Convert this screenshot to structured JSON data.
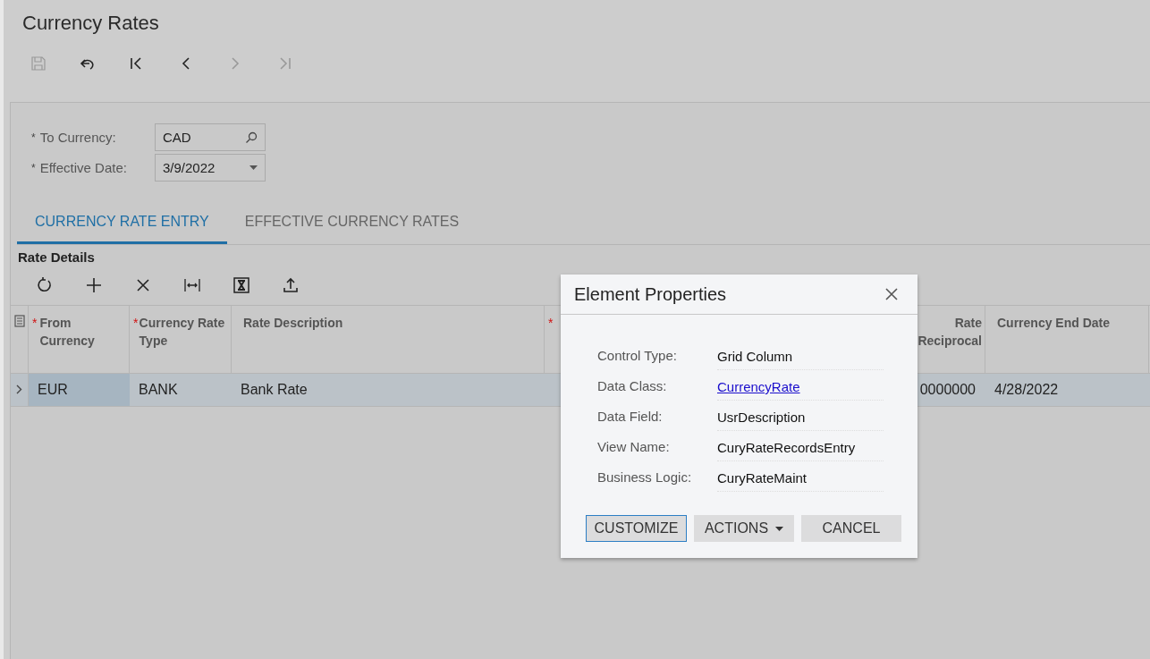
{
  "page": {
    "title": "Currency Rates"
  },
  "toolbar": [
    {
      "kind": "save",
      "disabled": true
    },
    {
      "kind": "undo",
      "disabled": false
    },
    {
      "kind": "first",
      "disabled": false
    },
    {
      "kind": "prev",
      "disabled": false
    },
    {
      "kind": "next",
      "disabled": true
    },
    {
      "kind": "last",
      "disabled": true
    }
  ],
  "form": [
    {
      "mark": "*",
      "label": "To Currency:",
      "value": "CAD",
      "kind": "lookup"
    },
    {
      "mark": "*",
      "label": "Effective Date:",
      "value": "3/9/2022",
      "kind": "dropdown"
    }
  ],
  "tabs": [
    {
      "label": "CURRENCY RATE ENTRY",
      "selected": true
    },
    {
      "label": "EFFECTIVE CURRENCY RATES",
      "selected": false
    }
  ],
  "grid": {
    "title": "Rate Details",
    "toolbar": [
      {
        "kind": "refresh"
      },
      {
        "kind": "add"
      },
      {
        "kind": "delete"
      },
      {
        "kind": "fit"
      },
      {
        "kind": "excel"
      },
      {
        "kind": "upload"
      }
    ],
    "columns": [
      {
        "mark": "*",
        "label": "From Currency"
      },
      {
        "mark": "*",
        "label": "Currency Rate Type"
      },
      {
        "label": "Rate Description"
      },
      {
        "mark": "*"
      },
      {
        "label": "Rate Reciprocal"
      },
      {
        "label": "Currency End Date"
      }
    ],
    "rows": [
      {
        "selected": true,
        "cells": [
          "EUR",
          "BANK",
          "Bank Rate",
          "",
          "0000000",
          "4/28/2022"
        ]
      }
    ]
  },
  "dialog": {
    "title": "Element Properties",
    "properties": [
      {
        "label": "Control Type:",
        "value": "Grid Column",
        "kind": "text"
      },
      {
        "label": "Data Class:",
        "value": "CurrencyRate",
        "kind": "link"
      },
      {
        "label": "Data Field:",
        "value": "UsrDescription",
        "kind": "text"
      },
      {
        "label": "View Name:",
        "value": "CuryRateRecordsEntry",
        "kind": "text"
      },
      {
        "label": "Business Logic:",
        "value": "CuryRateMaint",
        "kind": "text"
      }
    ],
    "buttons": [
      {
        "label": "CUSTOMIZE",
        "focused": true,
        "dropdown": false
      },
      {
        "label": "ACTIONS",
        "focused": false,
        "dropdown": true
      },
      {
        "label": "CANCEL",
        "focused": false,
        "dropdown": false
      }
    ]
  }
}
